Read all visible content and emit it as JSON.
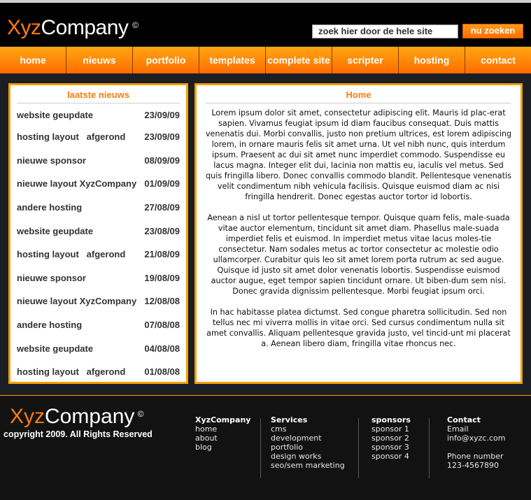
{
  "header": {
    "logo": {
      "part1": "Xyz",
      "part2": "Company",
      "copyright_symbol": "©"
    },
    "search": {
      "placeholder": "zoek hier door de hele site",
      "button_label": "nu zoeken"
    }
  },
  "nav": {
    "items": [
      {
        "label": "home"
      },
      {
        "label": "nieuws"
      },
      {
        "label": "portfolio"
      },
      {
        "label": "templates"
      },
      {
        "label": "complete site"
      },
      {
        "label": "scripter"
      },
      {
        "label": "hosting"
      },
      {
        "label": "contact"
      }
    ]
  },
  "news": {
    "title": "laatste nieuws",
    "items": [
      {
        "title": "website geupdate",
        "date": "23/09/09"
      },
      {
        "title": "hosting layout   afgerond",
        "date": "23/09/09"
      },
      {
        "title": "nieuwe sponsor",
        "date": "08/09/09"
      },
      {
        "title": "nieuwe layout XyzCompany",
        "date": "01/09/09"
      },
      {
        "title": "andere hosting",
        "date": "27/08/09"
      },
      {
        "title": "website geupdate",
        "date": "23/08/09"
      },
      {
        "title": "hosting layout   afgerond",
        "date": "21/08/09"
      },
      {
        "title": "nieuwe sponsor",
        "date": "19/08/09"
      },
      {
        "title": "nieuwe layout XyzCompany",
        "date": "12/08/08"
      },
      {
        "title": "andere hosting",
        "date": "07/08/08"
      },
      {
        "title": "website geupdate",
        "date": "04/08/08"
      },
      {
        "title": "hosting layout   afgerond",
        "date": "01/08/08"
      }
    ]
  },
  "main": {
    "title": "Home",
    "paragraphs": [
      "Lorem ipsum dolor sit amet, consectetur adipiscing elit. Mauris id plac-erat sapien. Vivamus feugiat ipsum id diam faucibus consequat. Duis mattis venenatis dui. Morbi convallis, justo non pretium ultrices, est lorem adipiscing lorem, in ornare mauris felis sit amet urna. Ut vel nibh nunc, quis interdum ipsum. Praesent ac dui sit amet nunc imperdiet commodo. Suspendisse eu lacus magna. Integer elit dui, lacinia non mattis eu, iaculis vel metus. Sed quis fringilla libero. Donec convallis commodo blandit. Pellentesque venenatis velit condimentum nibh vehicula facilisis. Quisque euismod diam ac nisi fringilla hendrerit. Donec egestas auctor tortor id lobortis.",
      "Aenean a nisl ut tortor pellentesque tempor. Quisque quam felis, male-suada vitae auctor elementum, tincidunt sit amet diam. Phasellus male-suada imperdiet felis et euismod. In imperdiet metus vitae lacus moles-tie consectetur. Nam sodales metus ac tortor consectetur ac molestie odio ullamcorper. Curabitur quis leo sit amet lorem porta rutrum ac sed augue. Quisque id justo sit amet dolor venenatis lobortis. Suspendisse euismod auctor augue, eget tempor sapien tincidunt ornare. Ut biben-dum sem nisi. Donec gravida dignissim pellentesque. Morbi feugiat ipsum orci.",
      "In hac habitasse platea dictumst. Sed congue pharetra sollicitudin. Sed non tellus nec mi viverra mollis in vitae orci. Sed cursus condimentum nulla sit amet convallis. Aliquam pellentesque gravida justo, vel tincid-unt mi placerat a. Aenean libero diam, fringilla vitae rhoncus nec."
    ]
  },
  "footer": {
    "logo": {
      "part1": "Xyz",
      "part2": "Company",
      "copyright_symbol": "©"
    },
    "copyright": "copyright 2009. All Rights Reserved",
    "columns": {
      "company": {
        "heading": "XyzCompany",
        "links": [
          "home",
          "about",
          "blog"
        ]
      },
      "services": {
        "heading": "Services",
        "links": [
          "cms",
          "development",
          "portfolio",
          "design works",
          "seo/sem marketing"
        ]
      },
      "sponsors": {
        "heading": "sponsors",
        "links": [
          "sponsor 1",
          "sponsor 2",
          "sponsor 3",
          "sponsor 4"
        ]
      },
      "contact": {
        "heading": "Contact",
        "email_label": "Email",
        "email": "info@xyzc.com",
        "phone_label": "Phone number",
        "phone": "123-4567890"
      }
    }
  },
  "colors": {
    "accent": "#ff7a10",
    "panel_border": "#f5a000",
    "header_bg": "#000000",
    "footer_bg": "#121212",
    "body_bg": "#1b1e25"
  }
}
